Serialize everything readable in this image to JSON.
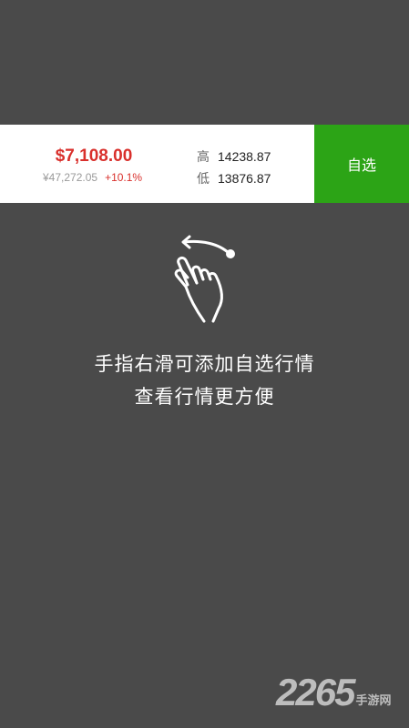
{
  "quote": {
    "price_usd": "$7,108.00",
    "price_cny": "¥47,272.05",
    "change": "+10.1%",
    "high_label": "高",
    "high_value": "14238.87",
    "low_label": "低",
    "low_value": "13876.87"
  },
  "actions": {
    "favorite_label": "自选"
  },
  "hint": {
    "line1": "手指右滑可添加自选行情",
    "line2": "查看行情更方便"
  },
  "watermark": {
    "number": "2265",
    "site": "手游网"
  },
  "colors": {
    "background": "#4a4a4a",
    "price_red": "#d9302c",
    "favorite_green": "#2ca416"
  },
  "icons": {
    "gesture": "swipe-hand-icon"
  }
}
